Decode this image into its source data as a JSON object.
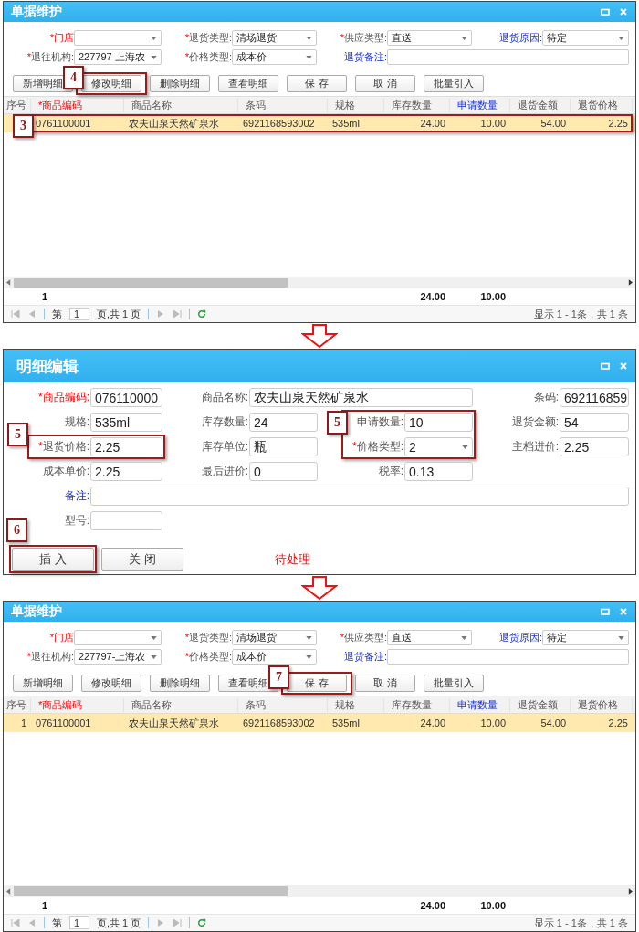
{
  "panels": [
    {
      "kind": "list",
      "title": "单据维护",
      "filter_rows": [
        [
          {
            "mark": "*",
            "label": "门店",
            "emphasized": true,
            "kind": "select"
          },
          {
            "mark": "*",
            "label": "退货类型:",
            "kind": "select",
            "value": "清场退货"
          },
          {
            "mark": "*",
            "label": "供应类型:",
            "kind": "select",
            "value": "直送"
          },
          {
            "label": "退货原因:",
            "link": true,
            "kind": "select",
            "value": "待定"
          }
        ],
        [
          {
            "mark": "*",
            "label": "退往机构:",
            "kind": "select",
            "value": "227797-上海农"
          },
          {
            "mark": "*",
            "label": "价格类型:",
            "kind": "select",
            "value": "成本价"
          },
          {
            "label": "退货备注:",
            "link": true,
            "kind": "wide-text"
          }
        ]
      ],
      "buttons": [
        {
          "label": "新增明细"
        },
        {
          "label": "修改明细",
          "callout": {
            "number": "4"
          }
        },
        {
          "label": "删除明细"
        },
        {
          "label": "查看明细"
        },
        {
          "label": "保 存"
        },
        {
          "label": "取 消"
        },
        {
          "label": "批量引入"
        }
      ],
      "columns": [
        {
          "label": "序号"
        },
        {
          "label": "*商品编码",
          "emphasized": true,
          "total": "1"
        },
        {
          "label": "商品名称"
        },
        {
          "label": "条码"
        },
        {
          "label": "规格"
        },
        {
          "label": "库存数量",
          "numeric": true,
          "total": "24.00"
        },
        {
          "label": "申请数量",
          "link": true,
          "numeric": true,
          "total": "10.00"
        },
        {
          "label": "退货金额",
          "numeric": true
        },
        {
          "label": "退货价格",
          "numeric": true
        }
      ],
      "rows": [
        {
          "selected": true,
          "callout": {
            "number": "3"
          },
          "cells": [
            null,
            "0761100001",
            "农夫山泉天然矿泉水",
            "6921168593002",
            "535ml",
            "24.00",
            "10.00",
            "54.00",
            "2.25"
          ]
        }
      ],
      "pager": {
        "page_prefix": "第",
        "page": "1",
        "page_suffix": "页,共 1 页",
        "summary": "显示 1 - 1条，共 1 条"
      }
    },
    {
      "kind": "edit",
      "title": "明细编辑",
      "field_rows": [
        [
          {
            "mark": "*",
            "label": "商品编码:",
            "emphasized": true,
            "kind": "text",
            "value": "076110000"
          },
          {
            "label": "商品名称:",
            "kind": "wide-text",
            "value": "农夫山泉天然矿泉水"
          },
          {
            "label": "条码:",
            "kind": "text",
            "value": "692116859"
          }
        ],
        [
          {
            "label": "规格:",
            "kind": "text",
            "value": "535ml"
          },
          {
            "label": "库存数量:",
            "kind": "text",
            "value": "24"
          },
          {
            "label": "申请数量:",
            "kind": "text",
            "value": "10",
            "callout": {
              "number": "5",
              "tall": true
            }
          },
          {
            "label": "退货金额:",
            "kind": "text",
            "value": "54"
          }
        ],
        [
          {
            "mark": "*",
            "label": "退货价格:",
            "kind": "text",
            "value": "2.25",
            "callout": {
              "number": "5"
            }
          },
          {
            "label": "库存单位:",
            "kind": "text",
            "value": "瓶"
          },
          {
            "mark": "*",
            "label": "价格类型:",
            "kind": "select",
            "value": "2"
          },
          {
            "label": "主档进价:",
            "kind": "text",
            "value": "2.25"
          }
        ],
        [
          {
            "label": "成本单价:",
            "kind": "text",
            "value": "2.25"
          },
          {
            "label": "最后进价:",
            "kind": "text",
            "value": "0"
          },
          {
            "label": "税率:",
            "kind": "text",
            "value": "0.13"
          }
        ],
        [
          {
            "label": "备注:",
            "link": true,
            "kind": "wide-text"
          }
        ],
        [
          {
            "label": "型号:",
            "kind": "text"
          }
        ]
      ],
      "buttons": [
        {
          "label": "插 入",
          "callout": {
            "number": "6"
          }
        },
        {
          "label": "关 闭"
        }
      ],
      "status": "待处理"
    },
    {
      "kind": "list",
      "title": "单据维护",
      "filter_rows": [
        [
          {
            "mark": "*",
            "label": "门店",
            "emphasized": true,
            "kind": "select"
          },
          {
            "mark": "*",
            "label": "退货类型:",
            "kind": "select",
            "value": "清场退货"
          },
          {
            "mark": "*",
            "label": "供应类型:",
            "kind": "select",
            "value": "直送"
          },
          {
            "label": "退货原因:",
            "link": true,
            "kind": "select",
            "value": "待定"
          }
        ],
        [
          {
            "mark": "*",
            "label": "退往机构:",
            "kind": "select",
            "value": "227797-上海农"
          },
          {
            "mark": "*",
            "label": "价格类型:",
            "kind": "select",
            "value": "成本价"
          },
          {
            "label": "退货备注:",
            "link": true,
            "kind": "wide-text"
          }
        ]
      ],
      "buttons": [
        {
          "label": "新增明细"
        },
        {
          "label": "修改明细"
        },
        {
          "label": "删除明细"
        },
        {
          "label": "查看明细"
        },
        {
          "label": "保 存",
          "callout": {
            "number": "7"
          }
        },
        {
          "label": "取 消"
        },
        {
          "label": "批量引入"
        }
      ],
      "columns": [
        {
          "label": "序号"
        },
        {
          "label": "*商品编码",
          "emphasized": true,
          "total": "1"
        },
        {
          "label": "商品名称"
        },
        {
          "label": "条码"
        },
        {
          "label": "规格"
        },
        {
          "label": "库存数量",
          "numeric": true,
          "total": "24.00"
        },
        {
          "label": "申请数量",
          "link": true,
          "numeric": true,
          "total": "10.00"
        },
        {
          "label": "退货金额",
          "numeric": true
        },
        {
          "label": "退货价格",
          "numeric": true
        }
      ],
      "rows": [
        {
          "selected": true,
          "cells": [
            "1",
            "0761100001",
            "农夫山泉天然矿泉水",
            "6921168593002",
            "535ml",
            "24.00",
            "10.00",
            "54.00",
            "2.25"
          ]
        }
      ],
      "pager": {
        "page_prefix": "第",
        "page": "1",
        "page_suffix": "页,共 1 页",
        "summary": "显示 1 - 1条，共 1 条"
      }
    }
  ]
}
